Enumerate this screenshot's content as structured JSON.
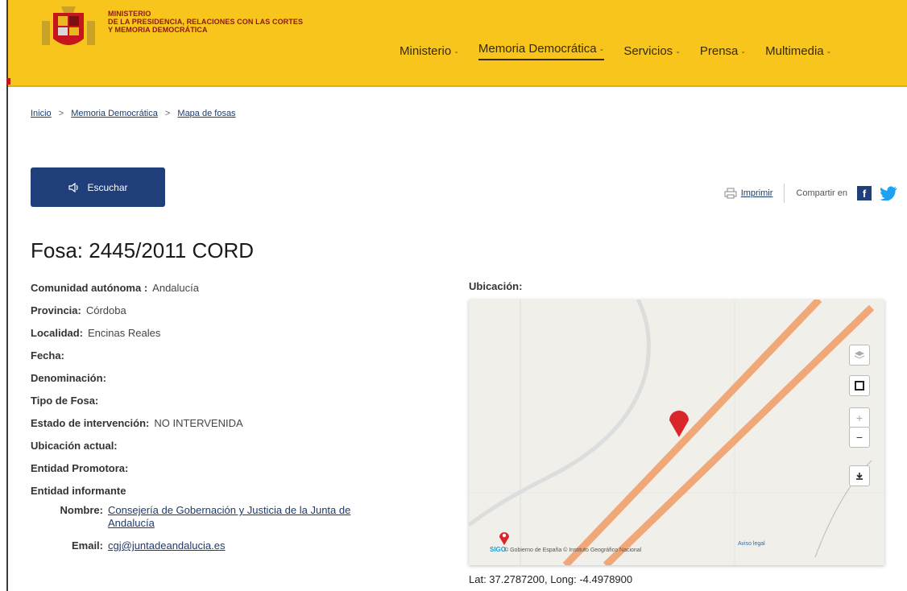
{
  "header": {
    "ministry_line1": "MINISTERIO",
    "ministry_line2": "DE LA PRESIDENCIA, RELACIONES CON LAS CORTES",
    "ministry_line3": "Y MEMORIA DEMOCRÁTICA",
    "nav": [
      {
        "label": "Ministerio"
      },
      {
        "label": "Memoria Democrática"
      },
      {
        "label": "Servicios"
      },
      {
        "label": "Prensa"
      },
      {
        "label": "Multimedia"
      }
    ],
    "accent": "#f7c51c",
    "brand_blue": "#1f3e7a"
  },
  "breadcrumb": [
    "Inicio",
    "Memoria Democrática",
    "Mapa de fosas"
  ],
  "listen_button": "Escuchar",
  "share": {
    "print_label": "Imprimir",
    "share_label": "Compartir en",
    "icons": [
      "facebook-icon",
      "twitter-icon"
    ]
  },
  "title": "Fosa: 2445/2011 CORD",
  "fields": [
    {
      "label": "Comunidad autónoma :",
      "value": "Andalucía"
    },
    {
      "label": "Provincia:",
      "value": "Córdoba"
    },
    {
      "label": "Localidad:",
      "value": "Encinas Reales"
    },
    {
      "label": "Fecha:",
      "value": ""
    },
    {
      "label": "Denominación:",
      "value": ""
    },
    {
      "label": "Tipo de Fosa:",
      "value": ""
    },
    {
      "label": "Estado de intervención:",
      "value": "NO INTERVENIDA"
    },
    {
      "label": "Ubicación actual:",
      "value": ""
    },
    {
      "label": "Entidad Promotora:",
      "value": ""
    },
    {
      "label": "Entidad informante",
      "value": ""
    }
  ],
  "informant": {
    "name_label": "Nombre:",
    "name_value": "Consejería de Gobernación y Justicia de la Junta de Andalucía",
    "email_label": "Email:",
    "email_value": "cgj@juntadeandalucia.es"
  },
  "map": {
    "section_label": "Ubicación:",
    "attribution": "© Gobierno de España  © Instituto Geográfico Nacional",
    "aviso": "Aviso legal",
    "logo_text": "SIGO",
    "controls": [
      "layers-icon",
      "fullscreen-icon",
      "zoom-in-button",
      "zoom-out-button",
      "download-icon"
    ],
    "zoom_in": "+",
    "zoom_out": "−",
    "latlong": "Lat: 37.2787200, Long: -4.4978900"
  }
}
